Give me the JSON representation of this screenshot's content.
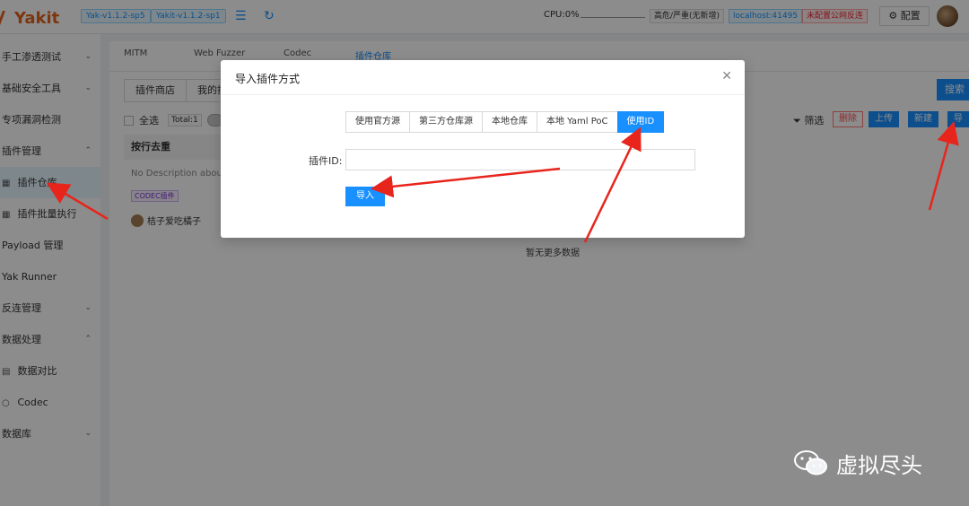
{
  "topbar": {
    "app_name": "Yakit",
    "version_tags": [
      "Yak-v1.1.2-sp5",
      "Yakit-v1.1.2-sp1"
    ],
    "cpu_label": "CPU:0%",
    "risk_label": "高危/严重(无新增)",
    "host_label": "localhost:41495",
    "warn_label": "未配置公网反连",
    "config_label": "配置"
  },
  "sidebar": {
    "items": [
      {
        "label": "手工渗透测试",
        "chevron": "⌄"
      },
      {
        "label": "基础安全工具",
        "chevron": "⌄"
      },
      {
        "label": "专项漏洞检测",
        "chevron": ""
      },
      {
        "label": "插件管理",
        "chevron": "⌃"
      },
      {
        "label": "插件仓库",
        "chevron": "",
        "icon": "▦"
      },
      {
        "label": "插件批量执行",
        "chevron": "",
        "icon": "▦"
      },
      {
        "label": "Payload 管理",
        "chevron": ""
      },
      {
        "label": "Yak Runner",
        "chevron": ""
      },
      {
        "label": "反连管理",
        "chevron": "⌄"
      },
      {
        "label": "数据处理",
        "chevron": "⌃"
      },
      {
        "label": "数据对比",
        "chevron": "",
        "icon": "▤"
      },
      {
        "label": "Codec",
        "chevron": "",
        "icon": "○"
      },
      {
        "label": "数据库",
        "chevron": "⌄"
      }
    ]
  },
  "main": {
    "tabs": [
      "MITM",
      "Web Fuzzer",
      "Codec",
      "插件仓库"
    ],
    "subtabs": [
      "插件商店",
      "我的插"
    ],
    "search_label": "搜索",
    "select_all": "全选",
    "total": "Total:1",
    "filter": "筛选",
    "actions": {
      "delete": "删除",
      "upload": "上传",
      "new": "新建",
      "import": "导入"
    },
    "card": {
      "title": "按行去重",
      "description": "No Description about",
      "tag": "CODEC插件",
      "author": "桔子爱吃橘子"
    },
    "no_more": "暂无更多数据"
  },
  "modal": {
    "title": "导入插件方式",
    "options": [
      "使用官方源",
      "第三方仓库源",
      "本地仓库",
      "本地 Yaml PoC",
      "使用ID"
    ],
    "selected_option": "使用ID",
    "field_label": "插件ID:",
    "field_value": "",
    "import_button": "导入"
  },
  "watermark": {
    "text": "虚拟尽头"
  },
  "colors": {
    "primary": "#1890ff",
    "danger": "#ff4d4f",
    "annotation": "#e8251c"
  }
}
